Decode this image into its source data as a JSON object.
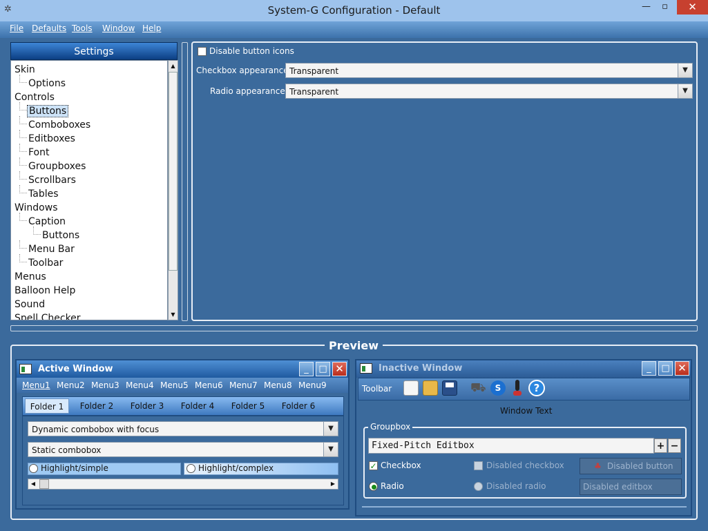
{
  "window": {
    "title": "System-G Configuration - Default"
  },
  "menubar": {
    "file": "File",
    "defaults": "Defaults",
    "tools": "Tools",
    "window": "Window",
    "help": "Help"
  },
  "settings": {
    "header": "Settings",
    "tree": [
      "Skin",
      "Options",
      "Controls",
      "Buttons",
      "Comboboxes",
      "Editboxes",
      "Font",
      "Groupboxes",
      "Scrollbars",
      "Tables",
      "Windows",
      "Caption",
      "Buttons",
      "Menu Bar",
      "Toolbar",
      "Menus",
      "Balloon Help",
      "Sound",
      "Spell Checker"
    ]
  },
  "right": {
    "disable_icons": "Disable button icons",
    "checkbox_label": "Checkbox appearance:",
    "checkbox_value": "Transparent",
    "radio_label": "Radio appearance:",
    "radio_value": "Transparent"
  },
  "preview": {
    "title": "Preview",
    "active": {
      "caption": "Active Window",
      "menus": [
        "Menu1",
        "Menu2",
        "Menu3",
        "Menu4",
        "Menu5",
        "Menu6",
        "Menu7",
        "Menu8",
        "Menu9"
      ],
      "tabs": [
        "Folder 1",
        "Folder 2",
        "Folder 3",
        "Folder 4",
        "Folder 5",
        "Folder 6"
      ],
      "combo1": "Dynamic combobox with focus",
      "combo2": "Static combobox",
      "hl_simple": "Highlight/simple",
      "hl_complex": "Highlight/complex"
    },
    "inactive": {
      "caption": "Inactive Window",
      "toolbar": "Toolbar",
      "window_text": "Window Text",
      "groupbox": "Groupbox",
      "edit": "Fixed-Pitch Editbox",
      "checkbox": "Checkbox",
      "disabled_checkbox": "Disabled checkbox",
      "disabled_button": "Disabled button",
      "radio": "Radio",
      "disabled_radio": "Disabled radio",
      "disabled_editbox": "Disabled editbox"
    }
  }
}
